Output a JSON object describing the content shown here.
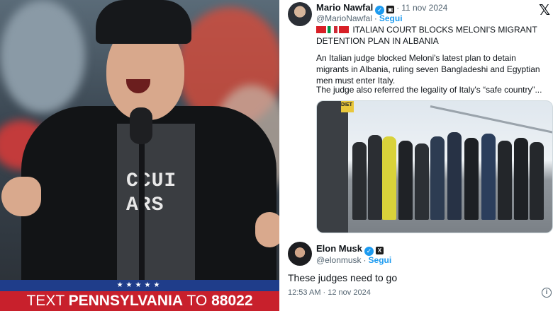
{
  "photo": {
    "shirt_text_line1": "CCUI",
    "shirt_text_line2": "ARS",
    "podium_stars": "★★★★★",
    "podium_text_prefix": "TEXT ",
    "podium_text_bold": "PENNSYLVANIA",
    "podium_text_mid": " TO ",
    "podium_text_number": "88022"
  },
  "tweet1": {
    "name": "Mario Nawfal",
    "handle": "@MarioNawfal",
    "follow": "Segui",
    "date": "11 nov 2024",
    "headline": "ITALIAN COURT BLOCKS MELONI'S MIGRANT DETENTION PLAN IN ALBANIA",
    "paragraph1": "An Italian judge blocked Meloni's latest plan to detain migrants in Albania, ruling seven Bangladeshi and Egyptian men must enter Italy.",
    "paragraph2": "The judge also referred the legality of Italy's “safe country”...",
    "media_sign": "DIET"
  },
  "tweet2": {
    "name": "Elon Musk",
    "handle": "@elonmusk",
    "follow": "Segui",
    "text": "These judges need to go",
    "timestamp": "12:53 AM · 12 nov 2024"
  },
  "icons": {
    "x_logo": "x-logo-icon",
    "verified": "verified-badge-icon",
    "affiliation": "affiliation-badge-icon",
    "info": "info-icon"
  },
  "colors": {
    "link_blue": "#1d9bf0",
    "text_secondary": "#536471",
    "podium_red": "#c8202c",
    "podium_blue": "#1f3d8a"
  }
}
